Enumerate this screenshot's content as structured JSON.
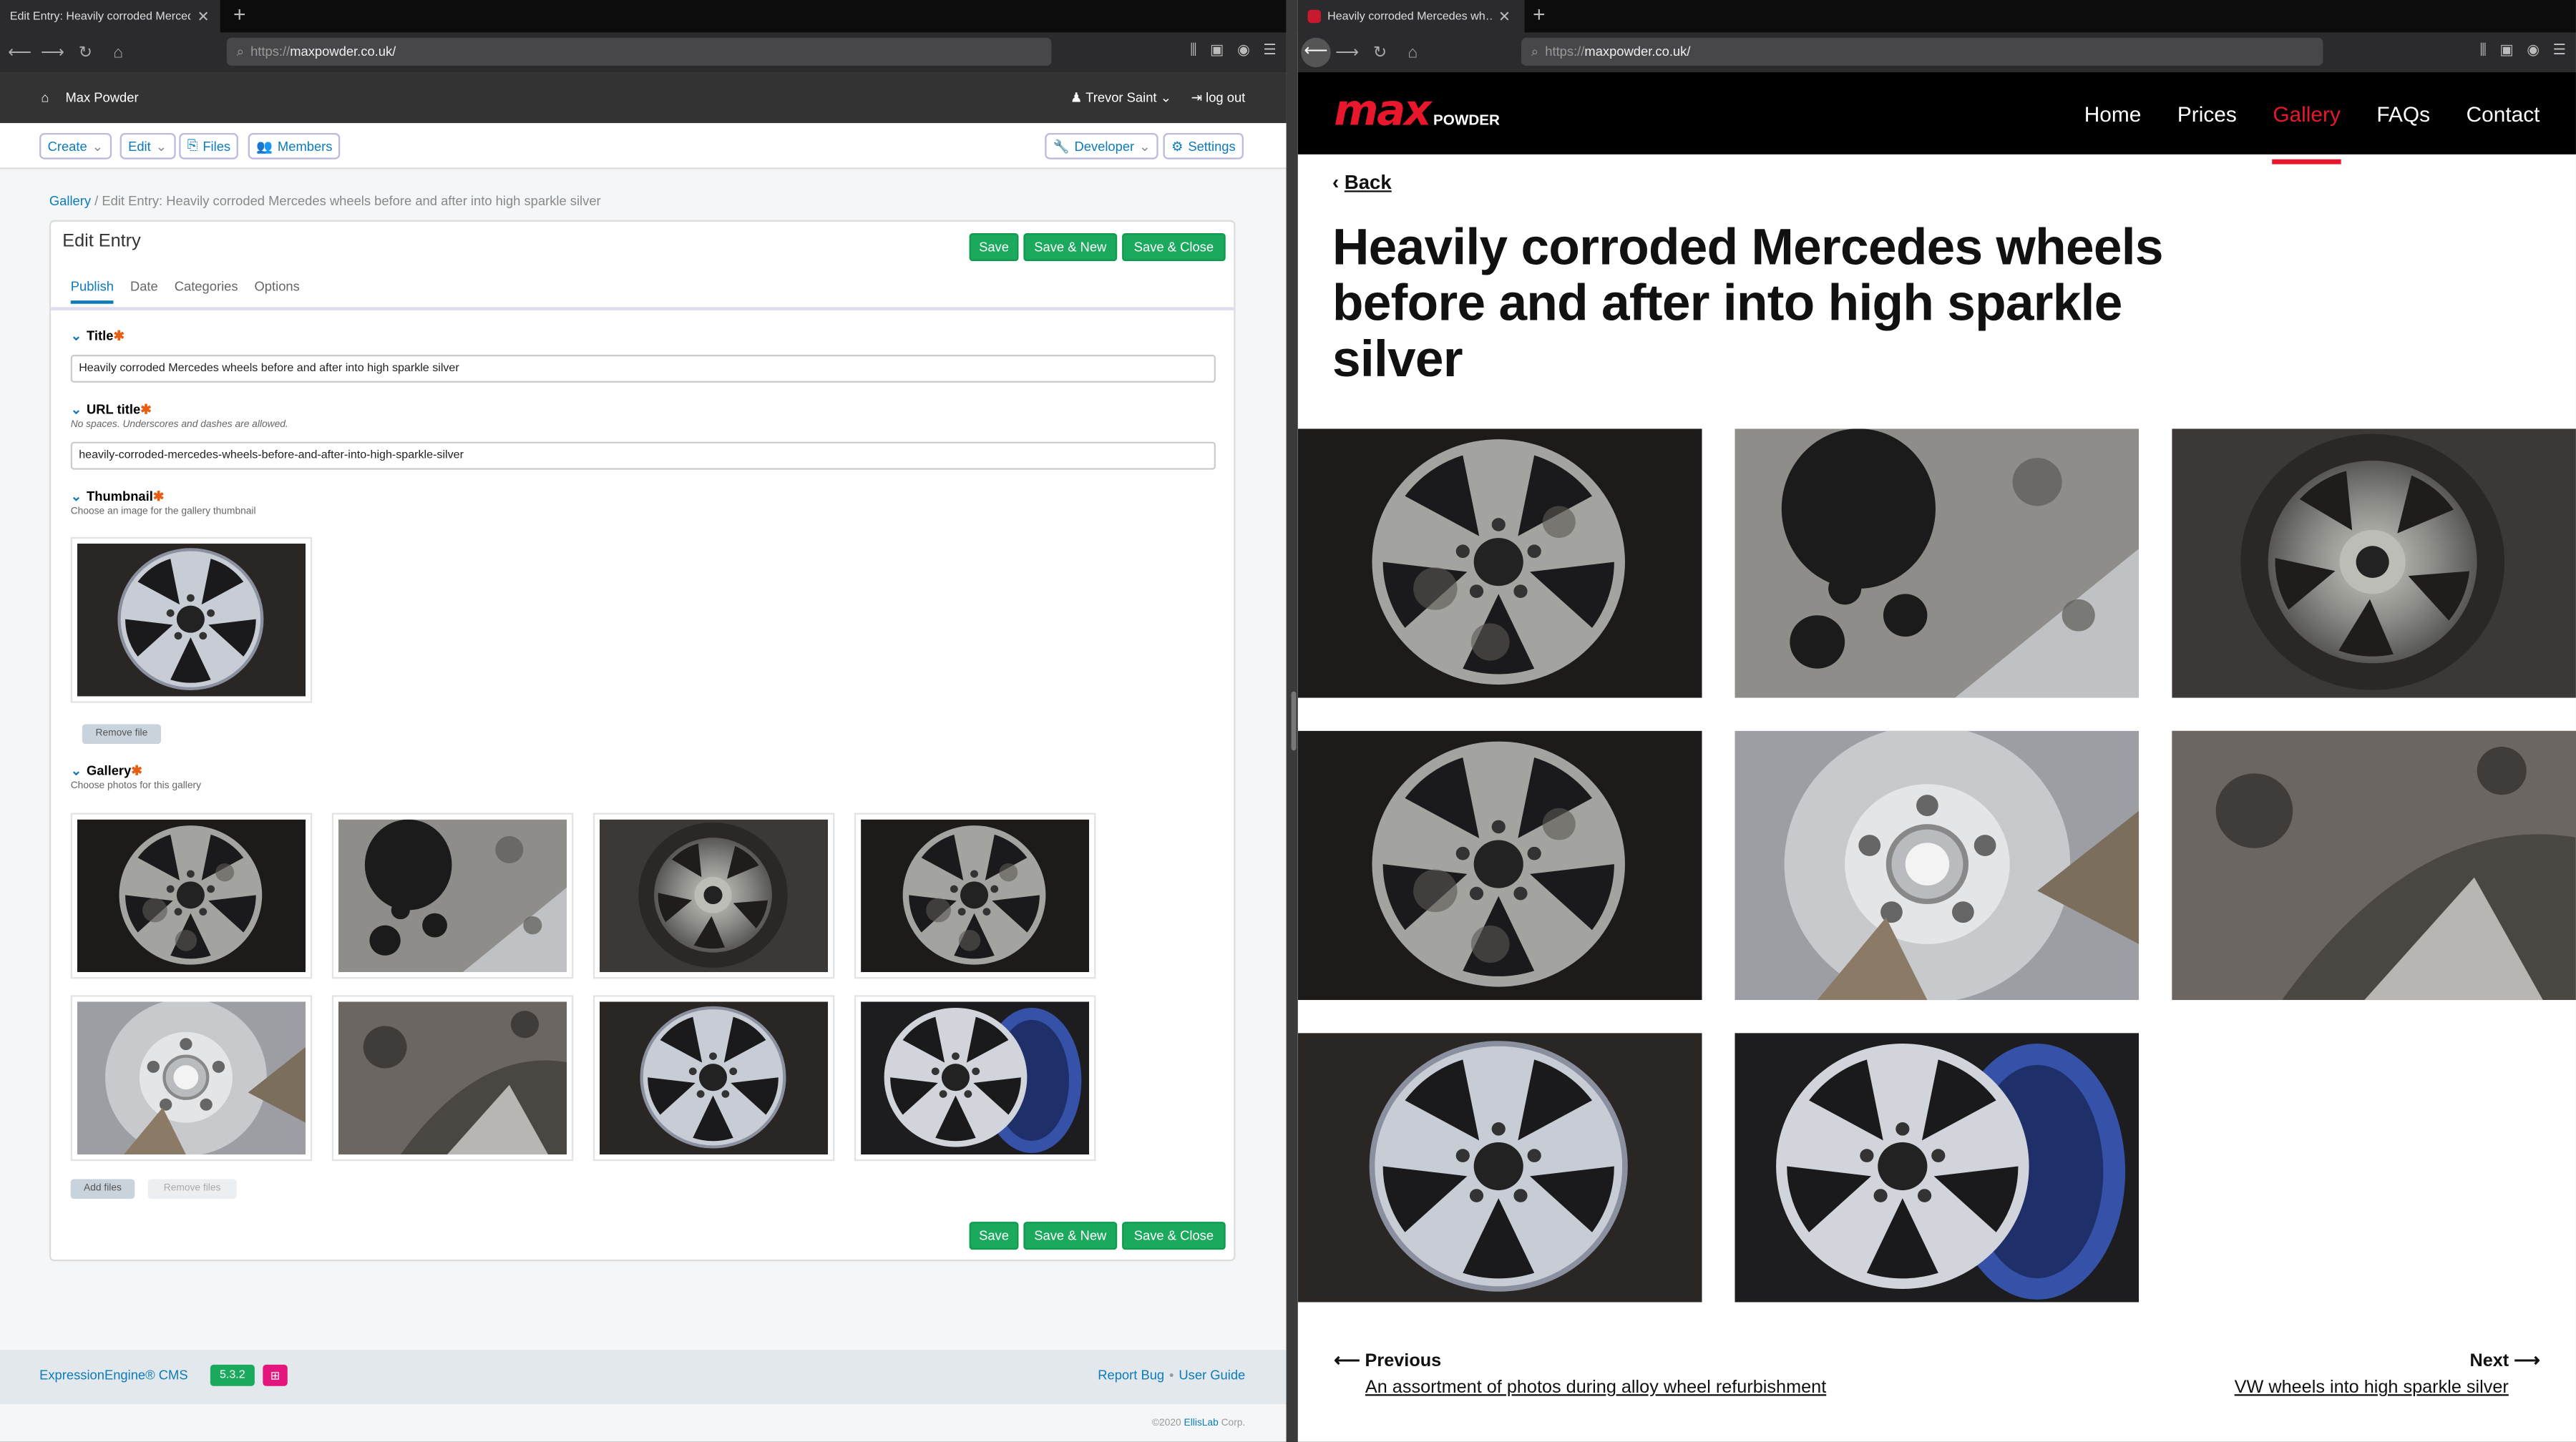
{
  "left_browser": {
    "tab_title": "Edit Entry: Heavily corroded Merced…",
    "url_prefix": "https://",
    "url_host": "maxpowder.co.uk/"
  },
  "right_browser": {
    "tab_title": "Heavily corroded Mercedes wh…",
    "url_prefix": "https://",
    "url_host": "maxpowder.co.uk/"
  },
  "cms": {
    "site_name": "Max Powder",
    "user": "Trevor Saint",
    "logout": "log out",
    "toolbar": {
      "create": "Create",
      "edit": "Edit",
      "files": "Files",
      "members": "Members",
      "developer": "Developer",
      "settings": "Settings"
    },
    "breadcrumb_link": "Gallery",
    "breadcrumb_current": "Edit Entry: Heavily corroded Mercedes wheels before and after into high sparkle silver",
    "panel_title": "Edit Entry",
    "buttons": {
      "save": "Save",
      "save_new": "Save & New",
      "save_close": "Save & Close"
    },
    "tabs": [
      "Publish",
      "Date",
      "Categories",
      "Options"
    ],
    "fields": {
      "title_label": "Title",
      "title_value": "Heavily corroded Mercedes wheels before and after into high sparkle silver",
      "url_label": "URL title",
      "url_hint": "No spaces. Underscores and dashes are allowed.",
      "url_value": "heavily-corroded-mercedes-wheels-before-and-after-into-high-sparkle-silver",
      "thumb_label": "Thumbnail",
      "thumb_hint": "Choose an image for the gallery thumbnail",
      "remove_file": "Remove file",
      "gallery_label": "Gallery",
      "gallery_hint": "Choose photos for this gallery",
      "add_files": "Add files",
      "remove_files": "Remove files"
    },
    "footer": {
      "brand": "ExpressionEngine® CMS",
      "version": "5.3.2",
      "report_bug": "Report Bug",
      "user_guide": "User Guide",
      "copyright": "©2020",
      "company": "EllisLab",
      "corp": "Corp."
    }
  },
  "site": {
    "logo_main": "max",
    "logo_sub": "POWDER",
    "nav": [
      "Home",
      "Prices",
      "Gallery",
      "FAQs",
      "Contact"
    ],
    "active_nav": "Gallery",
    "back": "Back",
    "title": "Heavily corroded Mercedes wheels before and after into high sparkle silver",
    "previous_label": "Previous",
    "previous_link": "An assortment of photos during alloy wheel refurbishment",
    "next_label": "Next",
    "next_link": "VW wheels into high sparkle silver"
  },
  "colors": {
    "brand_red": "#e8172c",
    "cms_blue": "#0d7bb9",
    "cms_green": "#1aa95d"
  }
}
